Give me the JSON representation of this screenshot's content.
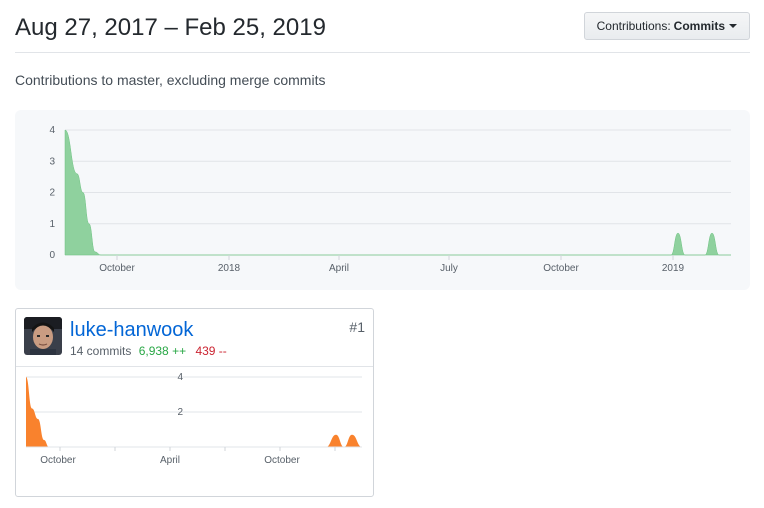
{
  "header": {
    "date_range": "Aug 27, 2017 – Feb 25, 2019"
  },
  "contributions_menu": {
    "label": "Contributions:",
    "selected": "Commits"
  },
  "subtitle": "Contributions to master, excluding merge commits",
  "colors": {
    "main_area": "#8fd19e",
    "main_stroke": "#6cc280",
    "card_area": "#f9822d",
    "link": "#0366d6",
    "additions": "#28a745",
    "deletions": "#cb2431"
  },
  "chart_data": [
    {
      "type": "area",
      "x": [
        "Aug 27, 2017",
        "Sep 3",
        "Sep 10",
        "Sep 17",
        "Sep 24",
        "Oct 1",
        "Oct 8",
        "Oct 15",
        "Dec 2018",
        "Dec 30",
        "Jan 6",
        "Jan 13",
        "Jan 20",
        "Jan 27",
        "Feb 3",
        "Feb 10",
        "Feb 17",
        "Feb 25, 2019"
      ],
      "y": [
        4,
        2.6,
        2.0,
        1.0,
        0.1,
        0,
        0,
        0,
        0,
        0,
        0.7,
        0,
        0,
        0.7,
        0,
        0,
        0,
        0
      ],
      "ylim": [
        0,
        4
      ],
      "yticks": [
        "0",
        "1",
        "2",
        "3",
        "4"
      ],
      "xticks": [
        "October",
        "2018",
        "April",
        "July",
        "October",
        "2019"
      ],
      "grid": true
    },
    {
      "type": "area",
      "y": [
        4,
        2.2,
        1.6,
        0.4,
        0,
        0,
        0,
        0,
        0.7,
        0,
        0.7,
        0
      ],
      "ylim": [
        0,
        4
      ],
      "yticks": [
        "4",
        "2"
      ],
      "xticks": [
        "October",
        "April",
        "October"
      ],
      "grid": true
    }
  ],
  "contributor": {
    "username": "luke-hanwook",
    "rank": "#1",
    "commits": "14 commits",
    "additions": "6,938 ++",
    "deletions": "439 --"
  }
}
